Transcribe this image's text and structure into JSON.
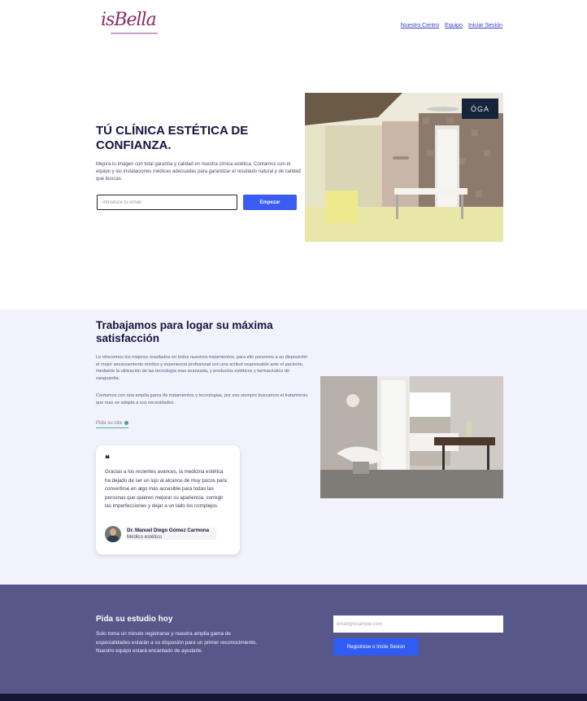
{
  "brand": {
    "logo_text": "isBella"
  },
  "nav": {
    "items": [
      "Nuestro Centro",
      "Equipo",
      "Iniciar Sesión"
    ]
  },
  "hero": {
    "title": "TÚ CLÍNICA ESTÉTICA DE CONFIANZA.",
    "description": "Mejora tu imagen con total garantía y calidad en nuestra clínica estética. Contamos con el equipo y las instalaciones médicas adecuadas para garantizar el resultado natural y de calidad que buscas.",
    "email_placeholder": "Introduce tu email",
    "button_label": "Empezar",
    "image_badge": "ÓGA"
  },
  "section2": {
    "title": "Trabajamos para logar su máxima satisfacción",
    "paragraph1": "Le ofrecemos los mejores resultados en todos nuestros tratamientos, para ello ponemos a su disposición el mejor asesoramiento médico y experiencia profesional con una actitud responsable ante el paciente, mediante la utilización de las tecnología mas avanzada, y productos estéticos y farmacéutico de vanguardia.",
    "paragraph2": "Contamos con una amplia gama de tratamientos y tecnologias, por eso siempre buscamos el tratamiento que mas se adapta a sus necesidades.",
    "link_label": "Pida su cita",
    "testimonial": {
      "quote_mark": "❝",
      "text": "Gracias a los recientes avances, la medicina estética ha dejado de ser un lujo al alcance de muy pocos para convertirse en algo más accesible para todas las personas que quieren mejorar su apariencia, corregir las imperfecciones y dejar a un lado los complejos.",
      "author_name": "Dr. Manuel Diego Gómez Carmona",
      "author_role": "Médico estético"
    }
  },
  "cta": {
    "title": "Pida su estudio hoy",
    "description": "Solo toma un minuto registrarse y nuestra amplia gama de especialidades estarán a su disposión para un primer reconocimiento. Nuestro equipo estará encantado de ayudarle.",
    "email_placeholder": "email@example.com",
    "button_label": "Registrese o Inicie Sesion"
  }
}
